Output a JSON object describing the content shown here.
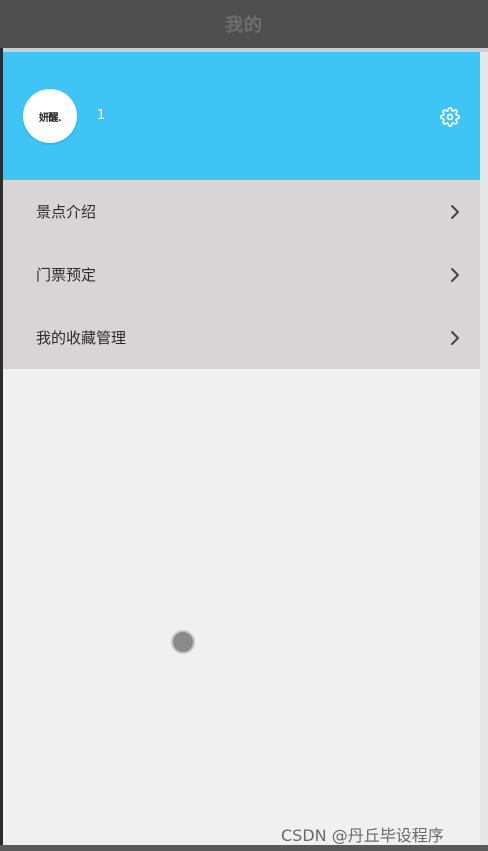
{
  "header": {
    "title": "我的"
  },
  "profile": {
    "avatar_text": "妍醒.",
    "username": "1",
    "settings_icon": "gear-icon",
    "background_color": "#3fc5f5"
  },
  "menu": {
    "items": [
      {
        "label": "景点介绍",
        "icon": "chevron-right-icon"
      },
      {
        "label": "门票预定",
        "icon": "chevron-right-icon"
      },
      {
        "label": "我的收藏管理",
        "icon": "chevron-right-icon"
      }
    ]
  },
  "watermark": {
    "text": "CSDN @丹丘毕设程序"
  }
}
